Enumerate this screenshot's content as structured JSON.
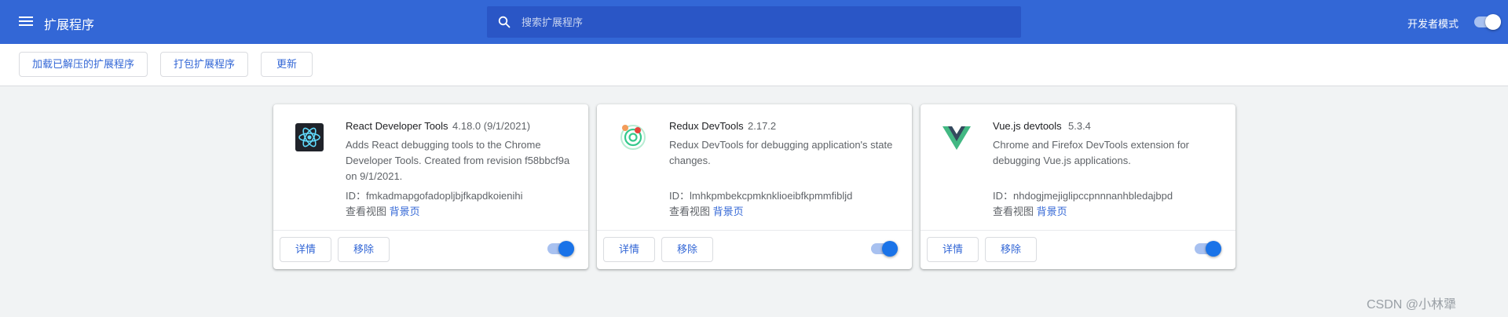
{
  "header": {
    "title": "扩展程序",
    "search_placeholder": "搜索扩展程序",
    "devmode_label": "开发者模式",
    "devmode_on": true
  },
  "toolbar": {
    "load_unpacked": "加载已解压的扩展程序",
    "pack": "打包扩展程序",
    "update": "更新"
  },
  "extensions": [
    {
      "name": "React Developer Tools",
      "version": "4.18.0 (9/1/2021)",
      "description": "Adds React debugging tools to the Chrome Developer Tools. Created from revision f58bbcf9a on 9/1/2021.",
      "id_label": "ID：",
      "id": "fmkadmapgofadopljbjfkapdkoienihi",
      "views_label": "查看视图",
      "views_link": "背景页",
      "details": "详情",
      "remove": "移除",
      "enabled": true,
      "icon": "react-icon"
    },
    {
      "name": "Redux DevTools",
      "version": "2.17.2",
      "description": "Redux DevTools for debugging application's state changes.",
      "id_label": "ID：",
      "id": "lmhkpmbekcpmknklioeibfkpmmfibljd",
      "views_label": "查看视图",
      "views_link": "背景页",
      "details": "详情",
      "remove": "移除",
      "enabled": true,
      "icon": "redux-icon"
    },
    {
      "name": "Vue.js devtools",
      "version": "5.3.4",
      "description": "Chrome and Firefox DevTools extension for debugging Vue.js applications.",
      "id_label": "ID：",
      "id": "nhdogjmejiglipccpnnnanhbledajbpd",
      "views_label": "查看视图",
      "views_link": "背景页",
      "details": "详情",
      "remove": "移除",
      "enabled": true,
      "icon": "vue-icon"
    }
  ],
  "watermark": "CSDN @小林犟",
  "colors": {
    "header_bg": "#3367d6",
    "accent": "#1a73e8",
    "link": "#3367d6"
  }
}
